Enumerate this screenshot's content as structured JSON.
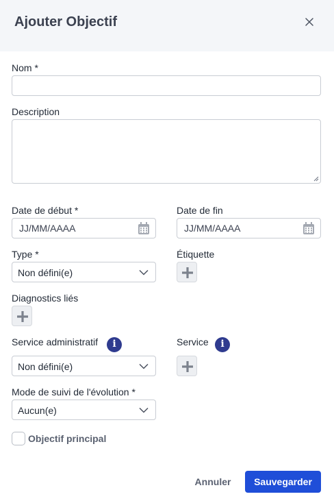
{
  "dialog": {
    "title": "Ajouter Objectif"
  },
  "form": {
    "name": {
      "label": "Nom *",
      "value": ""
    },
    "description": {
      "label": "Description",
      "value": ""
    },
    "start_date": {
      "label": "Date de début *",
      "placeholder": "JJ/MM/AAAA"
    },
    "end_date": {
      "label": "Date de fin",
      "placeholder": "JJ/MM/AAAA"
    },
    "type": {
      "label": "Type *",
      "selected": "Non défini(e)"
    },
    "tag": {
      "label": "Étiquette"
    },
    "linked_diagnostics": {
      "label": "Diagnostics liés"
    },
    "admin_service": {
      "label": "Service administratif",
      "selected": "Non défini(e)",
      "info_icon": "i"
    },
    "service": {
      "label": "Service",
      "info_icon": "i"
    },
    "tracking_mode": {
      "label": "Mode de suivi de l'évolution *",
      "selected": "Aucun(e)"
    },
    "main_objective": {
      "label": "Objectif principal",
      "checked": false
    }
  },
  "footer": {
    "cancel_label": "Annuler",
    "save_label": "Sauvegarder"
  },
  "colors": {
    "primary": "#1f4ed8",
    "info": "#2f3b8f",
    "header_bg": "#f4f6f9"
  },
  "icons": [
    "close-icon",
    "calendar-icon",
    "chevron-down-icon",
    "plus-icon",
    "info-icon"
  ]
}
